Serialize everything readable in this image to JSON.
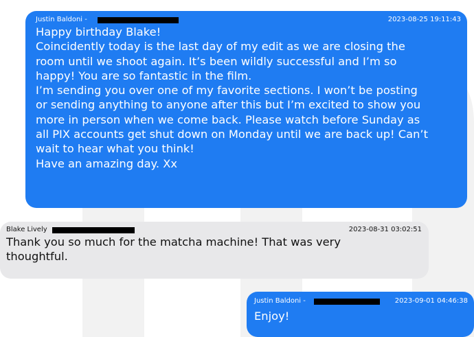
{
  "colors": {
    "sent_bubble": "#1f7cf2",
    "received_bubble": "#e8e8ea",
    "watermark": "#f2f2f2",
    "redaction": "#000000"
  },
  "watermark": {
    "icon": "m-logo-watermark"
  },
  "messages": [
    {
      "direction": "sent",
      "sender": "Justin Baldoni -",
      "sender_detail_redacted": true,
      "timestamp": "2023-08-25 19:11:43",
      "lines": [
        "Happy birthday Blake!",
        "Coincidently today is the last day of my edit as we are closing the",
        "room until we shoot again. It’s been wildly successful and I’m so",
        "happy! You are so fantastic in the film.",
        "I’m sending you over one of my favorite sections. I won’t be posting",
        "or sending anything to anyone after this but I’m excited to show you",
        "more in person when we come back. Please watch before Sunday as",
        "all PIX accounts get shut down on Monday until we are back up! Can’t",
        "wait to hear what you think!",
        "Have an amazing day. Xx"
      ]
    },
    {
      "direction": "received",
      "sender": "Blake Lively",
      "sender_detail_redacted": true,
      "timestamp": "2023-08-31 03:02:51",
      "lines": [
        "Thank you so much for the matcha machine! That was very",
        "thoughtful."
      ]
    },
    {
      "direction": "sent",
      "sender": "Justin Baldoni -",
      "sender_detail_redacted": true,
      "timestamp": "2023-09-01 04:46:38",
      "lines": [
        "Enjoy!"
      ]
    }
  ]
}
